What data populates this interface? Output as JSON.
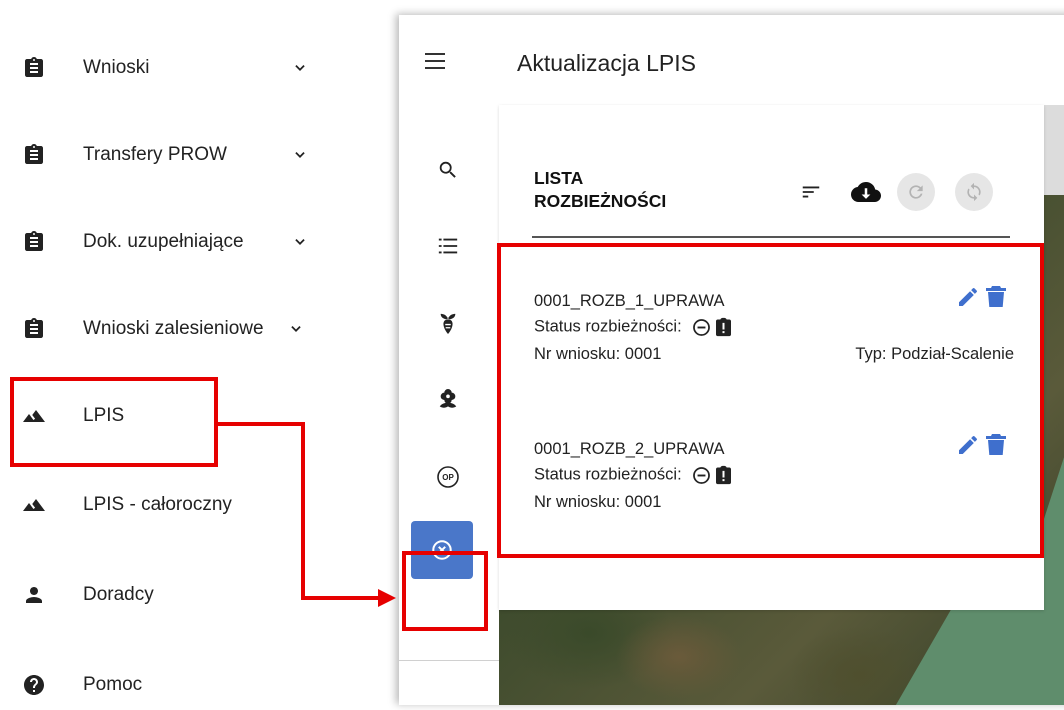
{
  "nav": {
    "items": [
      {
        "label": "Wnioski",
        "icon": "clipboard-icon",
        "chevron": true
      },
      {
        "label": "Transfery PROW",
        "icon": "clipboard-icon",
        "chevron": true
      },
      {
        "label": "Dok. uzupełniające",
        "icon": "clipboard-icon",
        "chevron": true
      },
      {
        "label": "Wnioski zalesieniowe",
        "icon": "clipboard-icon",
        "chevron": true
      },
      {
        "label": "LPIS",
        "icon": "mountains-icon",
        "chevron": false
      },
      {
        "label": "LPIS - całoroczny",
        "icon": "mountains-icon",
        "chevron": false
      },
      {
        "label": "Doradcy",
        "icon": "person-icon",
        "chevron": false
      },
      {
        "label": "Pomoc",
        "icon": "help-icon",
        "chevron": false
      }
    ]
  },
  "app": {
    "title": "Aktualizacja LPIS",
    "rail": [
      "search-icon",
      "list-icon",
      "sprout-icon",
      "flower-icon",
      "op-icon",
      "discrepancy-icon"
    ],
    "rail_op_label": "OP"
  },
  "panel": {
    "title": "LISTA ROZBIEŻNOŚCI",
    "tools": [
      "sort-icon",
      "cloud-download-icon",
      "refresh-icon",
      "sync-icon"
    ]
  },
  "entries": [
    {
      "name": "0001_ROZB_1_UPRAWA",
      "status_label": "Status rozbieżności:",
      "nr_label": "Nr wniosku: 0001",
      "typ": "Typ: Podział-Scalenie"
    },
    {
      "name": "0001_ROZB_2_UPRAWA",
      "status_label": "Status rozbieżności:",
      "nr_label": "Nr wniosku: 0001",
      "typ": ""
    }
  ],
  "colors": {
    "accent": "#4a77c9",
    "annotation": "#e60000",
    "action_icon": "#3f6fcd"
  }
}
